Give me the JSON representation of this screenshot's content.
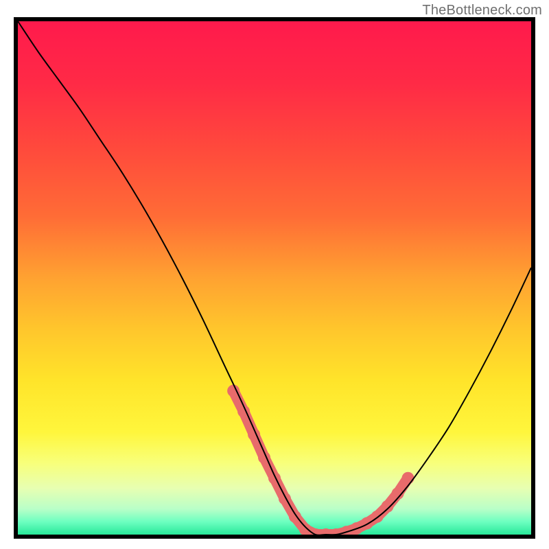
{
  "watermark": "TheBottleneck.com",
  "chart_data": {
    "type": "line",
    "title": "",
    "xlabel": "",
    "ylabel": "",
    "xlim": [
      0,
      100
    ],
    "ylim": [
      0,
      100
    ],
    "x": [
      0,
      4,
      8,
      12,
      16,
      20,
      24,
      28,
      32,
      36,
      40,
      44,
      48,
      50,
      52,
      54,
      56,
      58,
      60,
      62,
      64,
      68,
      72,
      76,
      80,
      84,
      88,
      92,
      96,
      100
    ],
    "values": [
      100,
      94,
      88.5,
      83,
      77,
      71,
      64.5,
      57.5,
      50,
      42,
      33.5,
      25,
      16,
      11.5,
      7.5,
      4,
      1.5,
      0,
      0,
      0,
      0.5,
      2,
      5,
      9.5,
      15,
      21,
      28,
      35.5,
      43.5,
      52
    ],
    "dot_points_x": [
      42,
      44,
      46,
      48,
      50,
      52,
      54,
      56,
      58,
      60,
      62,
      64,
      66,
      68,
      70,
      72,
      74,
      76
    ],
    "dot_points_y": [
      28,
      24,
      19.5,
      15,
      11,
      7,
      3.5,
      1,
      0,
      0,
      0,
      0.5,
      1.2,
      2.2,
      3.5,
      5.5,
      8,
      11
    ],
    "dot_color": "#e86b6b",
    "gradient_stops": [
      {
        "offset": 0.0,
        "color": "#ff1a4c"
      },
      {
        "offset": 0.12,
        "color": "#ff2a46"
      },
      {
        "offset": 0.25,
        "color": "#ff4a3c"
      },
      {
        "offset": 0.38,
        "color": "#ff6c36"
      },
      {
        "offset": 0.5,
        "color": "#ffa231"
      },
      {
        "offset": 0.6,
        "color": "#ffc62c"
      },
      {
        "offset": 0.7,
        "color": "#ffe42a"
      },
      {
        "offset": 0.8,
        "color": "#fff63c"
      },
      {
        "offset": 0.86,
        "color": "#f8ff7a"
      },
      {
        "offset": 0.91,
        "color": "#e7ffb2"
      },
      {
        "offset": 0.95,
        "color": "#b9ffc8"
      },
      {
        "offset": 0.975,
        "color": "#6dffc0"
      },
      {
        "offset": 1.0,
        "color": "#28e89a"
      }
    ]
  }
}
